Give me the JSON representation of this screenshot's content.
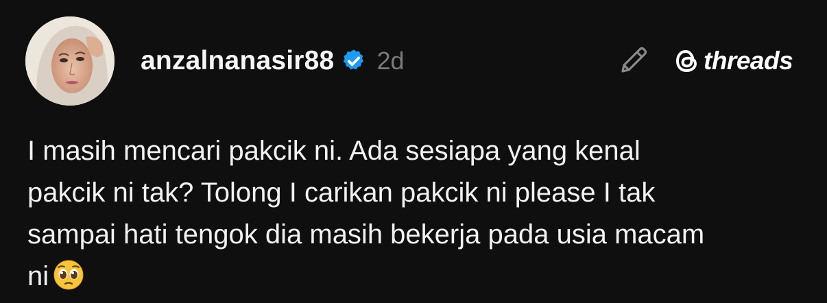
{
  "post": {
    "username": "anzalnanasir88",
    "timestamp": "2d",
    "verified": true,
    "text": "I masih mencari pakcik ni. Ada sesiapa yang kenal\npakcik ni tak? Tolong I carikan pakcik ni please I tak\nsampai hati tengok dia masih bekerja pada usia macam\nni",
    "emoji": "pleading-face"
  },
  "brand": {
    "label": "threads"
  },
  "icons": {
    "verified": "verified-badge-icon",
    "edit": "pencil-icon",
    "brand": "threads-logo-icon"
  },
  "colors": {
    "background": "#0f0f0f",
    "verified_badge": "#1d9bf0",
    "timestamp": "#7a7a7a"
  }
}
